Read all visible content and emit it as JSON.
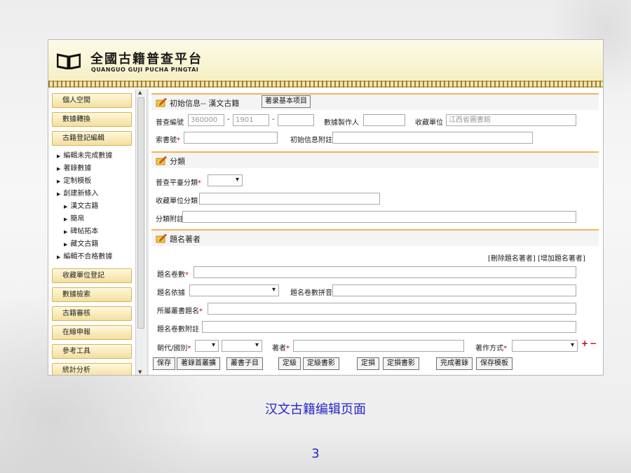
{
  "app": {
    "title": "全國古籍普查平台",
    "subtitle": "QUANGUO GUJI PUCHA PINGTAI"
  },
  "sidebar": {
    "buttons": [
      "個人空間",
      "數據轉換",
      "古籍登記編輯",
      "收藏單位登記",
      "數據檢索",
      "古籍審核",
      "在線申報",
      "參考工具",
      "統計分析"
    ],
    "items": [
      {
        "label": "編輯未完成數據"
      },
      {
        "label": "著錄數據"
      },
      {
        "label": "定制模板"
      },
      {
        "label": "創建新條入"
      },
      {
        "label": "漢文古籍"
      },
      {
        "label": "簡帛"
      },
      {
        "label": "碑帖拓本"
      },
      {
        "label": "藏文古籍"
      },
      {
        "label": "編輯不合格數據"
      }
    ]
  },
  "sections": {
    "initial": {
      "title": "初始信息-- 漢文古籍",
      "button": "著录基本项目"
    },
    "classify": {
      "title": "分類"
    },
    "titles": {
      "title": "題名著者",
      "actions": "[刪除題名著者] [增加題名著者]"
    }
  },
  "fields": {
    "survey_no_label": "普查編號",
    "survey_no_1": "360000",
    "survey_no_2": "1901",
    "survey_no_3": "",
    "data_maker_label": "數據製作人",
    "holding_unit_label": "收藏單位",
    "holding_unit_value": "江西省圖書館",
    "call_no_label": "索書號",
    "initial_note_label": "初始信息附註",
    "survey_class_label": "普查平臺分類",
    "unit_class_label": "收藏單位分類",
    "class_note_label": "分類附註",
    "title_vol_label": "題名卷數",
    "title_basis_label": "題名依據",
    "title_pinyin_label": "題名卷數拼音",
    "series_title_label": "所屬叢書題名",
    "title_note_label": "題名卷數附註",
    "dynasty_label": "朝代/國別",
    "author_label": "著者",
    "author_mode_label": "著作方式",
    "plus": "+",
    "minus": "−"
  },
  "toolbar": [
    "保存",
    "著錄首叢擴",
    "叢書子目",
    "定級",
    "定級書影",
    "定損",
    "定損書影",
    "完成著錄",
    "保存模板"
  ],
  "caption": "汉文古籍编辑页面",
  "page_number": "3",
  "colors": {
    "caption": "#2626c6",
    "section_accent": "#f2b459",
    "nav_button": "#f3df9e",
    "required": "#d40000"
  }
}
